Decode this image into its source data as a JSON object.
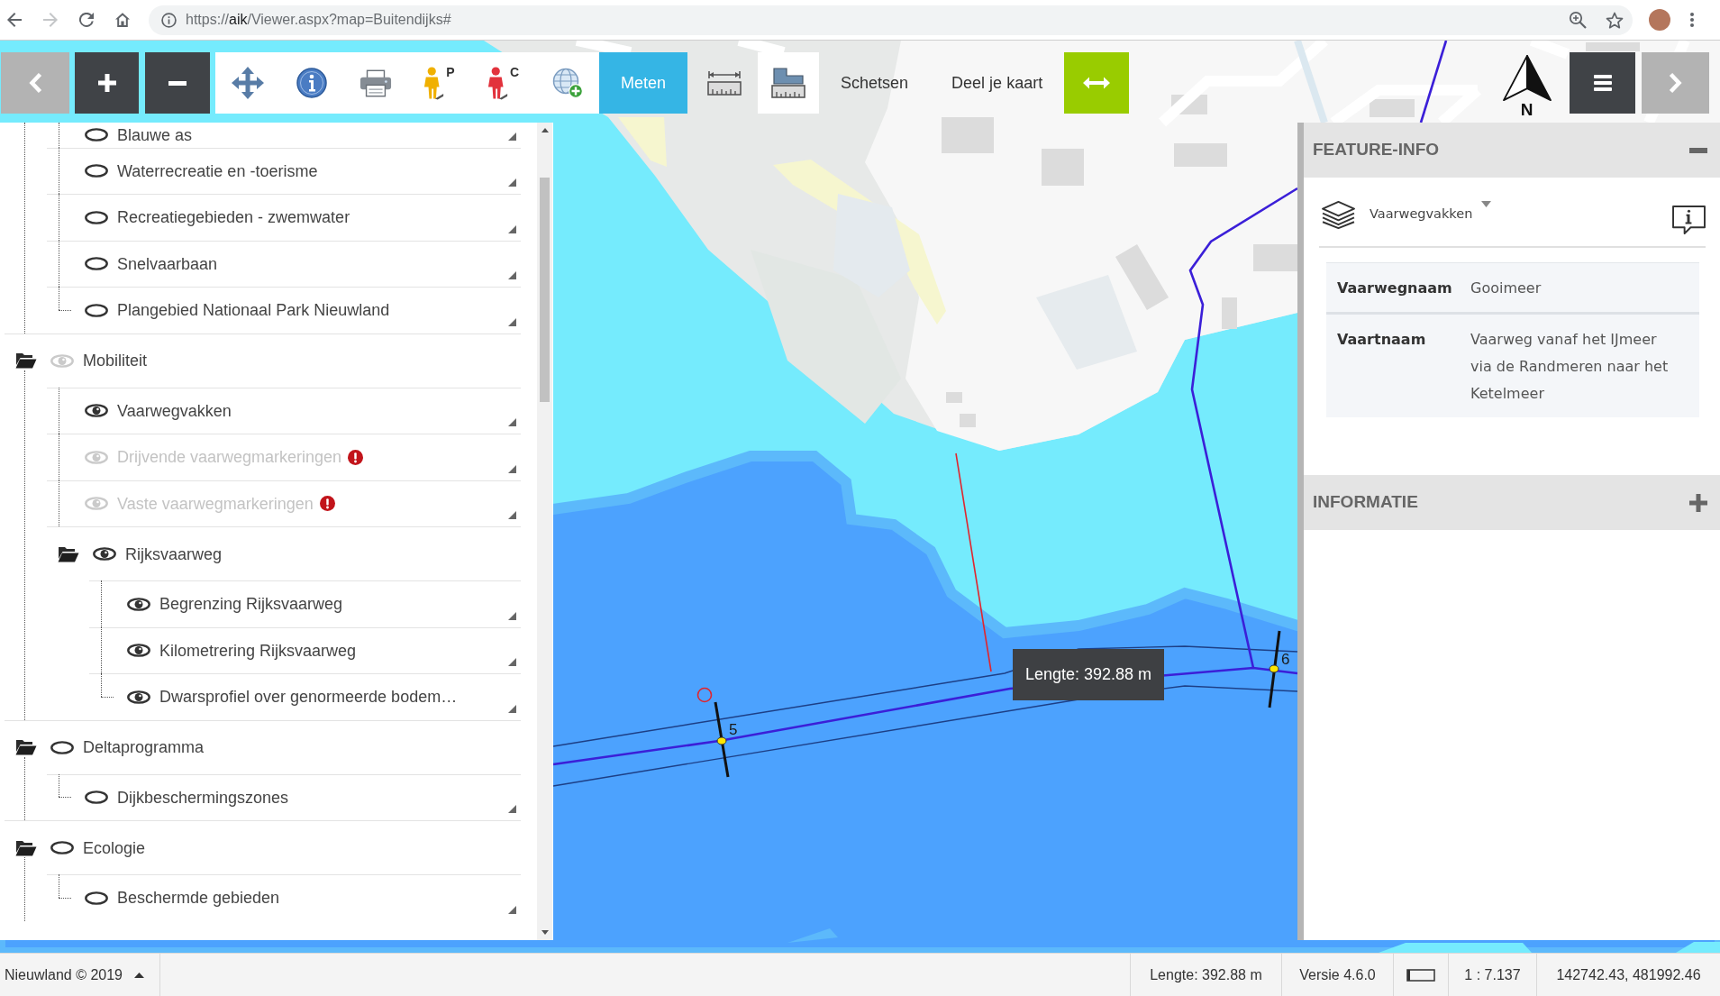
{
  "browser": {
    "nav": [
      {
        "kind": "back",
        "disabled": false
      },
      {
        "kind": "forward",
        "disabled": true
      },
      {
        "kind": "reload",
        "disabled": false
      },
      {
        "kind": "home",
        "disabled": false
      }
    ],
    "address": {
      "scheme": "https://",
      "host": "aik",
      "path": "/Viewer.aspx?map=Buitendijks#"
    }
  },
  "toolbar": [
    {
      "kind": "back"
    },
    {
      "kind": "zoom_in"
    },
    {
      "kind": "zoom_out"
    },
    {
      "kind": "pan"
    },
    {
      "kind": "info"
    },
    {
      "kind": "print"
    },
    {
      "kind": "person",
      "letter": "P",
      "color": "#f0b000"
    },
    {
      "kind": "person",
      "letter": "C",
      "color": "#e2323c"
    },
    {
      "kind": "add_layer"
    },
    {
      "kind": "text",
      "label": "Meten",
      "selected": true
    },
    {
      "kind": "ruler",
      "selected": false
    },
    {
      "kind": "ruler_area",
      "selected": true
    },
    {
      "kind": "text",
      "label": "Schetsen",
      "selected": false
    },
    {
      "kind": "text",
      "label": "Deel je kaart",
      "selected": false
    },
    {
      "kind": "swap"
    },
    {
      "kind": "north",
      "label": "N"
    },
    {
      "kind": "menu"
    },
    {
      "kind": "forward"
    }
  ],
  "layer_tree": [
    {
      "kind": "group",
      "children": [
        {
          "kind": "layer",
          "label": "Blauwe as",
          "visible": false,
          "disabled": false,
          "warning": false
        },
        {
          "kind": "layer",
          "label": "Waterrecreatie en -toerisme",
          "visible": false,
          "disabled": false,
          "warning": false
        },
        {
          "kind": "layer",
          "label": "Recreatiegebieden - zwemwater",
          "visible": false,
          "disabled": false,
          "warning": false
        },
        {
          "kind": "layer",
          "label": "Snelvaarbaan",
          "visible": false,
          "disabled": false,
          "warning": false
        },
        {
          "kind": "layer",
          "label": "Plangebied Nationaal Park Nieuwland",
          "visible": false,
          "disabled": false,
          "warning": false
        }
      ]
    },
    {
      "kind": "group",
      "label": "Mobiliteit",
      "expanded": true,
      "visible": true,
      "partial": true,
      "children": [
        {
          "kind": "layer",
          "label": "Vaarwegvakken",
          "visible": true,
          "disabled": false,
          "warning": false
        },
        {
          "kind": "layer",
          "label": "Drijvende vaarwegmarkeringen",
          "visible": true,
          "disabled": true,
          "warning": true
        },
        {
          "kind": "layer",
          "label": "Vaste vaarwegmarkeringen",
          "visible": true,
          "disabled": true,
          "warning": true
        },
        {
          "kind": "group",
          "label": "Rijksvaarweg",
          "expanded": true,
          "visible": true,
          "partial": false,
          "children": [
            {
              "kind": "layer",
              "label": "Begrenzing Rijksvaarweg",
              "visible": true,
              "disabled": false,
              "warning": false
            },
            {
              "kind": "layer",
              "label": "Kilometrering Rijksvaarweg",
              "visible": true,
              "disabled": false,
              "warning": false
            },
            {
              "kind": "layer",
              "label": "Dwarsprofiel over genormeerde bodem…",
              "visible": true,
              "disabled": false,
              "warning": false
            }
          ]
        }
      ]
    },
    {
      "kind": "group",
      "label": "Deltaprogramma",
      "expanded": true,
      "visible": false,
      "partial": false,
      "children": [
        {
          "kind": "layer",
          "label": "Dijkbeschermingszones",
          "visible": false,
          "disabled": false,
          "warning": false
        }
      ]
    },
    {
      "kind": "group",
      "label": "Ecologie",
      "expanded": true,
      "visible": false,
      "partial": false,
      "children": [
        {
          "kind": "layer",
          "label": "Beschermde gebieden",
          "visible": false,
          "disabled": false,
          "warning": false
        }
      ]
    }
  ],
  "map": {
    "km_markers": [
      {
        "label": "5"
      },
      {
        "label": "6"
      }
    ],
    "measurement": {
      "label": "Lengte: 392.88 m"
    }
  },
  "side_panels": [
    {
      "title": "FEATURE-INFO",
      "expanded": true,
      "layer": "Vaarwegvakken",
      "attributes": [
        {
          "label": "Vaarwegnaam",
          "value": "Gooimeer"
        },
        {
          "label": "Vaartnaam",
          "value": "Vaarweg vanaf het IJmeer via de Randmeren naar het Ketelmeer"
        }
      ]
    },
    {
      "title": "INFORMATIE",
      "expanded": false
    }
  ],
  "status_bar": {
    "copyright": "Nieuwland © 2019",
    "fields": [
      {
        "kind": "text",
        "text": "Lengte: 392.88 m"
      },
      {
        "kind": "text",
        "text": "Versie 4.6.0"
      },
      {
        "kind": "scale_bar"
      },
      {
        "kind": "text",
        "text": "1 : 7.137"
      },
      {
        "kind": "text",
        "text": "142742.43, 481992.46"
      }
    ]
  }
}
